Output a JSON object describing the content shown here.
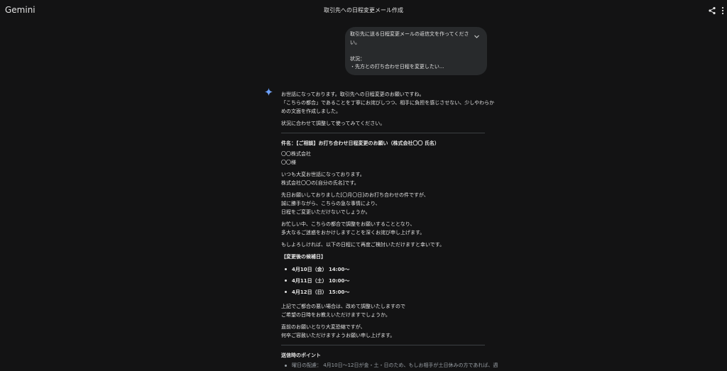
{
  "app": {
    "name": "Gemini"
  },
  "header": {
    "chat_title": "取引先への日程変更メール作成"
  },
  "user_message": {
    "lines": [
      "取引先に送る日程変更メールの返信文を作ってくださ",
      "い。",
      "",
      "状況：",
      "・先方との打ち合わせ日程を変更したい..."
    ]
  },
  "response": {
    "intro": [
      "お世話になっております。取引先への日程変更のお願いですね。",
      "「こちらの都合」であることを丁寧にお詫びしつつ、相手に負担を感じさせない、少しやわらか",
      "めの文面を作成しました。"
    ],
    "adjust_note": "状況に合わせて調整して使ってみてください。",
    "subject": "件名：【ご相談】お打ち合わせ日程変更のお願い（株式会社〇〇 氏名）",
    "recipient": [
      "〇〇株式会社",
      "〇〇様"
    ],
    "greeting": [
      "いつも大変お世話になっております。",
      "株式会社〇〇の[自分の氏名]です。"
    ],
    "request": [
      "先日お願いしておりました[〇月〇日]のお打ち合わせの件ですが、",
      "誠に勝手ながら、こちらの急な事情により、",
      "日程をご変更いただけないでしょうか。"
    ],
    "apology": [
      "お忙しい中、こちらの都合で調整をお願いすることとなり、",
      "多大なるご迷惑をおかけしますことを深くお詫び申し上げます。"
    ],
    "proposal": "もしよろしければ、以下の日程にて再度ご検討いただけますと幸いです。",
    "candidates_heading": "【変更後の候補日】",
    "candidates": [
      "4月10日（金） 14:00〜",
      "4月11日（土） 10:00〜",
      "4月12日（日） 15:00〜"
    ],
    "closing1": [
      "上記でご都合の悪い場合は、改めて調整いたしますので",
      "ご希望の日時をお教えいただけますでしょうか。"
    ],
    "closing2": [
      "直前のお願いとなり大変恐縮ですが、",
      "何卒ご容赦いただけますようお願い申し上げます。"
    ],
    "points_heading": "送信時のポイント",
    "points": [
      "曜日の配慮： 4月10日〜12日が金・土・日のため、もしお相手が土日休みの方であれば、週"
    ]
  }
}
